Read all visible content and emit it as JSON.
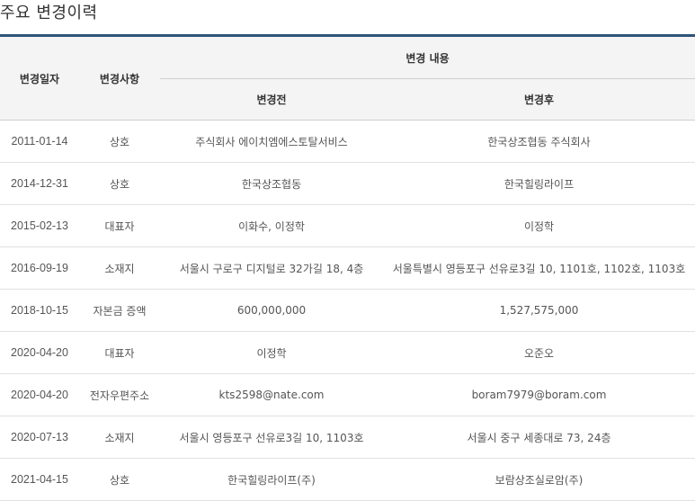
{
  "section_title": "주요 변경이력",
  "columns": {
    "date": "변경일자",
    "item": "변경사항",
    "group": "변경 내용",
    "before": "변경전",
    "after": "변경후"
  },
  "rows": [
    {
      "date": "2011-01-14",
      "item": "상호",
      "before": "주식회사 에이치엠에스토탈서비스",
      "after": "한국상조협동 주식회사"
    },
    {
      "date": "2014-12-31",
      "item": "상호",
      "before": "한국상조협동",
      "after": "한국힐링라이프"
    },
    {
      "date": "2015-02-13",
      "item": "대표자",
      "before": "이화수, 이정학",
      "after": "이정학"
    },
    {
      "date": "2016-09-19",
      "item": "소재지",
      "before": "서울시 구로구 디지털로 32가길 18, 4층",
      "after": "서울특별시 영등포구 선유로3길 10, 1101호, 1102호, 1103호"
    },
    {
      "date": "2018-10-15",
      "item": "자본금 증액",
      "before": "600,000,000",
      "after": "1,527,575,000"
    },
    {
      "date": "2020-04-20",
      "item": "대표자",
      "before": "이정학",
      "after": "오준오"
    },
    {
      "date": "2020-04-20",
      "item": "전자우편주소",
      "before": "kts2598@nate.com",
      "after": "boram7979@boram.com"
    },
    {
      "date": "2020-07-13",
      "item": "소재지",
      "before": "서울시 영등포구 선유로3길 10, 1103호",
      "after": "서울시 중구 세종대로 73, 24층"
    },
    {
      "date": "2021-04-15",
      "item": "상호",
      "before": "한국힐링라이프(주)",
      "after": "보람상조실로암(주)"
    }
  ]
}
